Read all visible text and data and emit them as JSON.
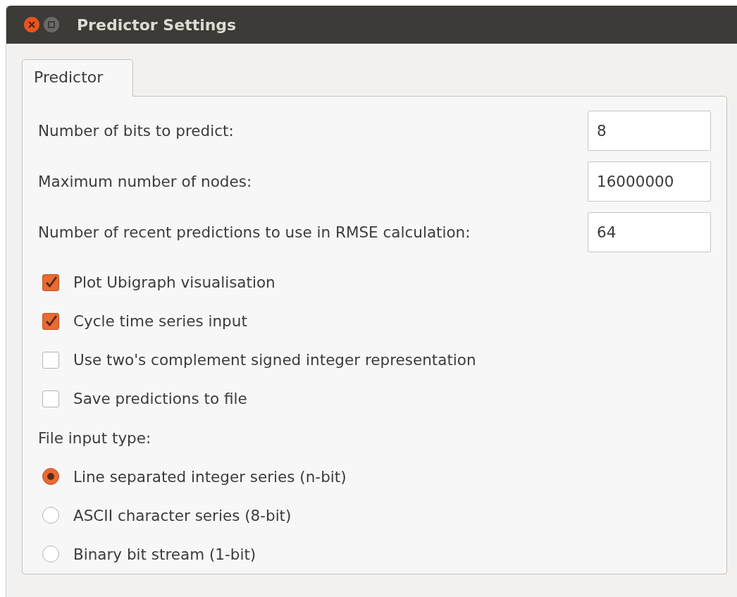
{
  "window": {
    "title": "Predictor Settings"
  },
  "tabs": [
    {
      "label": "Predictor",
      "selected": true
    }
  ],
  "fields": [
    {
      "label": "Number of bits to predict:",
      "value": "8"
    },
    {
      "label": "Maximum number of nodes:",
      "value": "16000000"
    },
    {
      "label": "Number of recent predictions to use in RMSE calculation:",
      "value": "64"
    }
  ],
  "checkboxes": [
    {
      "label": "Plot Ubigraph visualisation",
      "checked": true
    },
    {
      "label": "Cycle time series input",
      "checked": true
    },
    {
      "label": "Use two's complement signed integer representation",
      "checked": false
    },
    {
      "label": "Save predictions to file",
      "checked": false
    }
  ],
  "file_input_type": {
    "label": "File input type:",
    "options": [
      {
        "label": "Line separated integer series (n-bit)",
        "selected": true
      },
      {
        "label": "ASCII character series (8-bit)",
        "selected": false
      },
      {
        "label": "Binary bit stream (1-bit)",
        "selected": false
      }
    ]
  }
}
